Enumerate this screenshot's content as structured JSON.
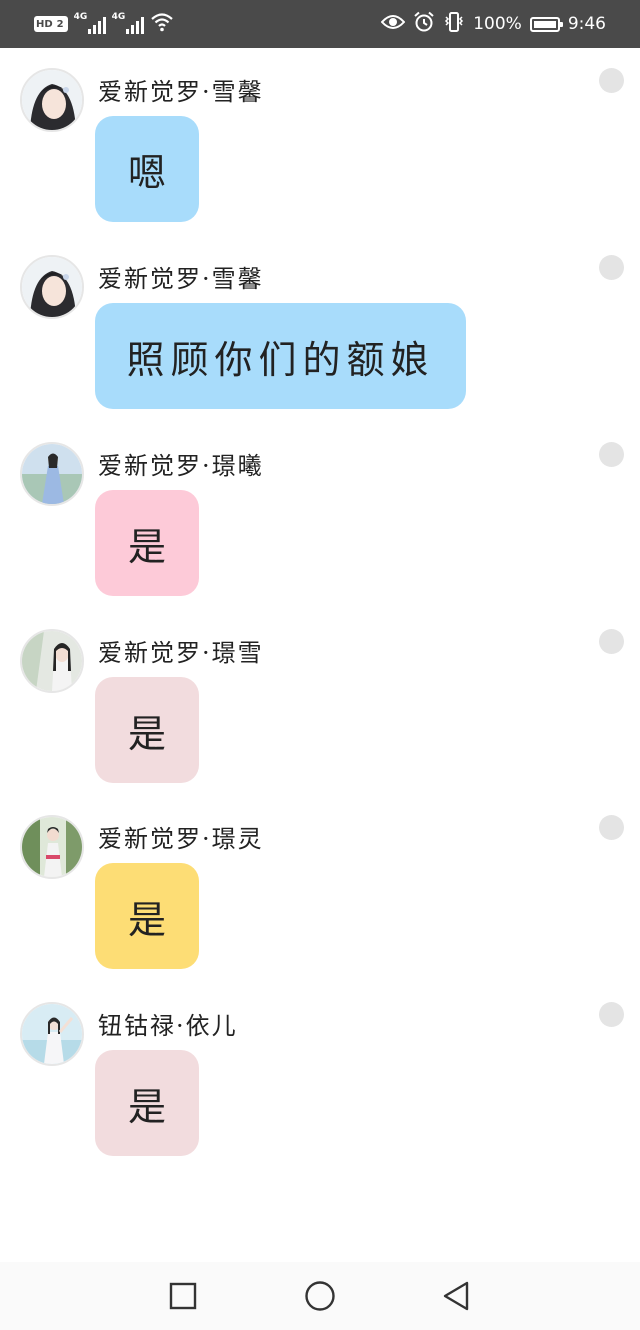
{
  "status_bar": {
    "hd_label": "HD",
    "sim_label": "2",
    "network_1": "4G",
    "network_2": "4G",
    "battery_percent": "100%",
    "time": "9:46",
    "icons": [
      "eye-icon",
      "alarm-icon",
      "vibrate-icon",
      "wifi-icon",
      "battery-icon"
    ]
  },
  "messages": [
    {
      "sender": "爱新觉罗·雪馨",
      "text": "嗯",
      "bubble_color": "#a8dcfb",
      "avatar": "avatar-1"
    },
    {
      "sender": "爱新觉罗·雪馨",
      "text": "照顾你们的额娘",
      "bubble_color": "#a8dcfb",
      "avatar": "avatar-1"
    },
    {
      "sender": "爱新觉罗·璟曦",
      "text": "是",
      "bubble_color": "#fdcad8",
      "avatar": "avatar-2"
    },
    {
      "sender": "爱新觉罗·璟雪",
      "text": "是",
      "bubble_color": "#f2dcde",
      "avatar": "avatar-3"
    },
    {
      "sender": "爱新觉罗·璟灵",
      "text": "是",
      "bubble_color": "#fddd75",
      "avatar": "avatar-4"
    },
    {
      "sender": "钮钴禄·依儿",
      "text": "是",
      "bubble_color": "#f2dcde",
      "avatar": "avatar-5"
    }
  ],
  "nav_bar": {
    "icons": [
      "recent-apps-icon",
      "home-icon",
      "back-icon"
    ]
  }
}
